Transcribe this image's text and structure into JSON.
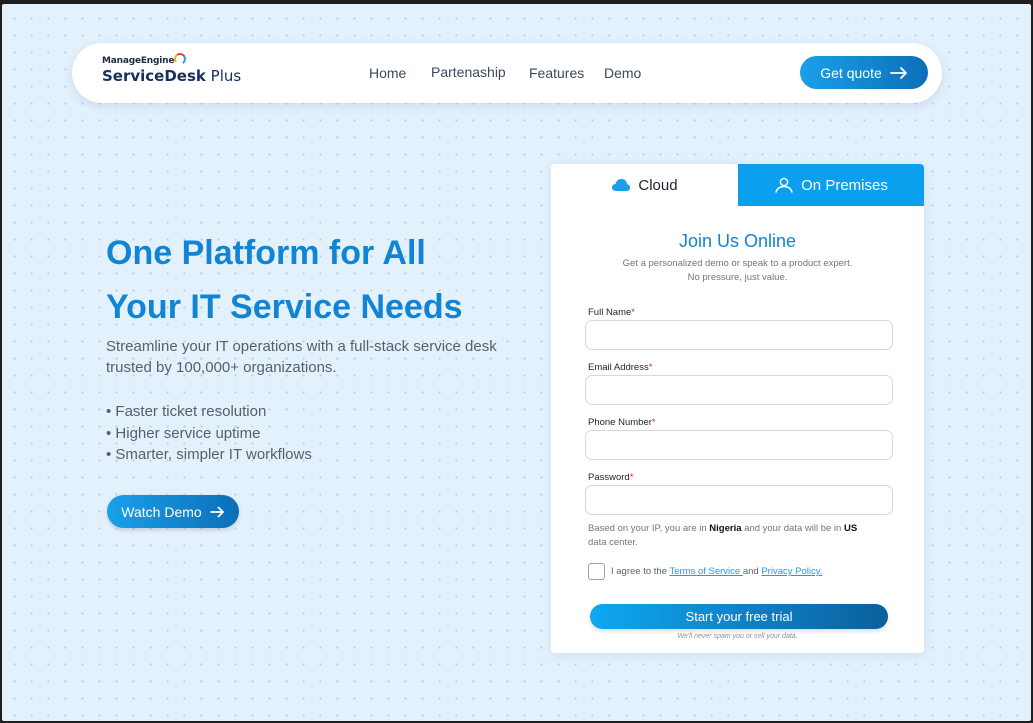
{
  "brand": {
    "top": "ManageEngine",
    "product": "ServiceDesk",
    "product_suffix": "Plus"
  },
  "nav": {
    "links": [
      "Home",
      "Partenaship",
      "Features",
      "Demo"
    ],
    "cta": "Get quote"
  },
  "hero": {
    "title_line1": "One Platform for All",
    "title_line2": "Your IT Service Needs",
    "subtitle": "Streamline your IT operations with a full-stack service desk trusted by 100,000+ organizations.",
    "bullets": [
      "• Faster ticket resolution",
      "• Higher service uptime",
      "• Smarter, simpler IT workflows"
    ],
    "watch_demo": "Watch Demo"
  },
  "form": {
    "tabs": {
      "cloud": "Cloud",
      "on_premises": "On Premises"
    },
    "active_tab": "Cloud",
    "title": "Join Us Online",
    "description": "Get a personalized demo or speak to a product expert. No pressure, just value.",
    "fields": [
      {
        "label": "Full Name",
        "value": ""
      },
      {
        "label": "Email Address",
        "value": ""
      },
      {
        "label": "Phone Number",
        "value": ""
      },
      {
        "label": "Password",
        "value": ""
      }
    ],
    "required_mark": "*",
    "ip_note": {
      "pre": "Based on your IP, you are in ",
      "country": "Nigeria",
      "mid": " and your data will be in ",
      "datacenter": "US",
      "post": " data center."
    },
    "agree": {
      "pre": "I agree to the ",
      "terms": "Terms of Service ",
      "and": "and ",
      "privacy": "Privacy Policy."
    },
    "submit": "Start your free trial",
    "spam_note": "We'll never spam you or sell your data."
  },
  "colors": {
    "accent": "#1185d3",
    "button_start": "#1aa0ea",
    "button_end": "#0b6fb7",
    "tab_active_bg": "#0aa0ee",
    "background": "#e3f1fc",
    "required": "#e12424"
  }
}
